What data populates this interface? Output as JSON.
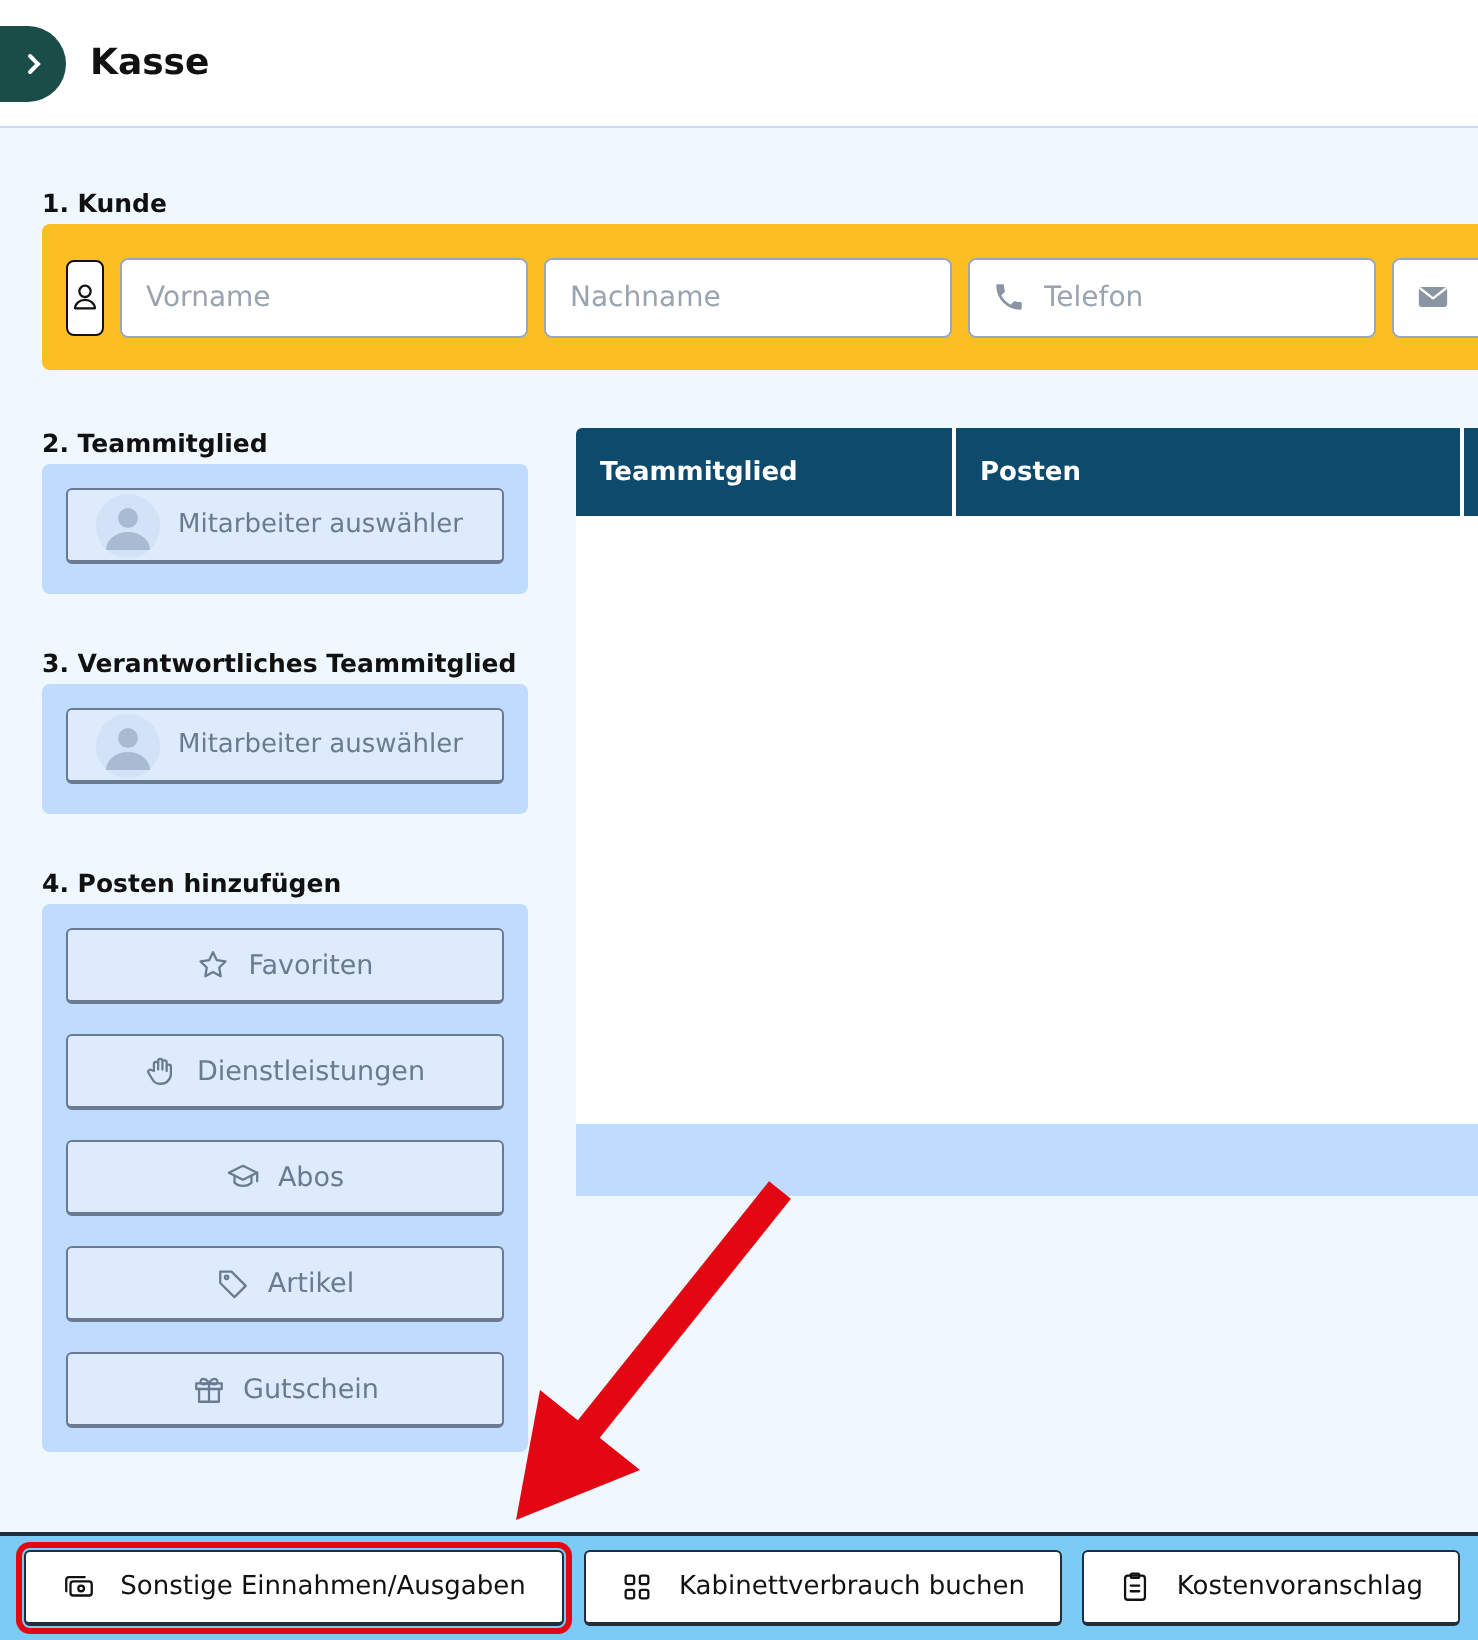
{
  "header": {
    "title": "Kasse"
  },
  "customer": {
    "label": "1. Kunde",
    "fields": [
      {
        "kind": "text",
        "placeholder": "Vorname"
      },
      {
        "kind": "text",
        "placeholder": "Nachname"
      },
      {
        "kind": "phone",
        "placeholder": "Telefon"
      },
      {
        "kind": "email"
      }
    ]
  },
  "team_member": {
    "label": "2. Teammitglied",
    "button": "Mitarbeiter auswähler"
  },
  "responsible_member": {
    "label": "3. Verantwortliches Teammitglied",
    "button": "Mitarbeiter auswähler"
  },
  "add_items": {
    "label": "4. Posten hinzufügen",
    "buttons": [
      {
        "kind": "star",
        "label": "Favoriten"
      },
      {
        "kind": "hand",
        "label": "Dienstleistungen"
      },
      {
        "kind": "cap",
        "label": "Abos"
      },
      {
        "kind": "tag",
        "label": "Artikel"
      },
      {
        "kind": "gift",
        "label": "Gutschein"
      }
    ]
  },
  "table": {
    "columns": [
      "Teammitglied",
      "Posten"
    ]
  },
  "bottom_bar": {
    "buttons": [
      {
        "kind": "cash",
        "label": "Sonstige Einnahmen/Ausgaben",
        "highlighted": true
      },
      {
        "kind": "grid",
        "label": "Kabinettverbrauch buchen",
        "highlighted": false
      },
      {
        "kind": "clipboard",
        "label": "Kostenvoranschlag",
        "highlighted": false
      }
    ]
  }
}
